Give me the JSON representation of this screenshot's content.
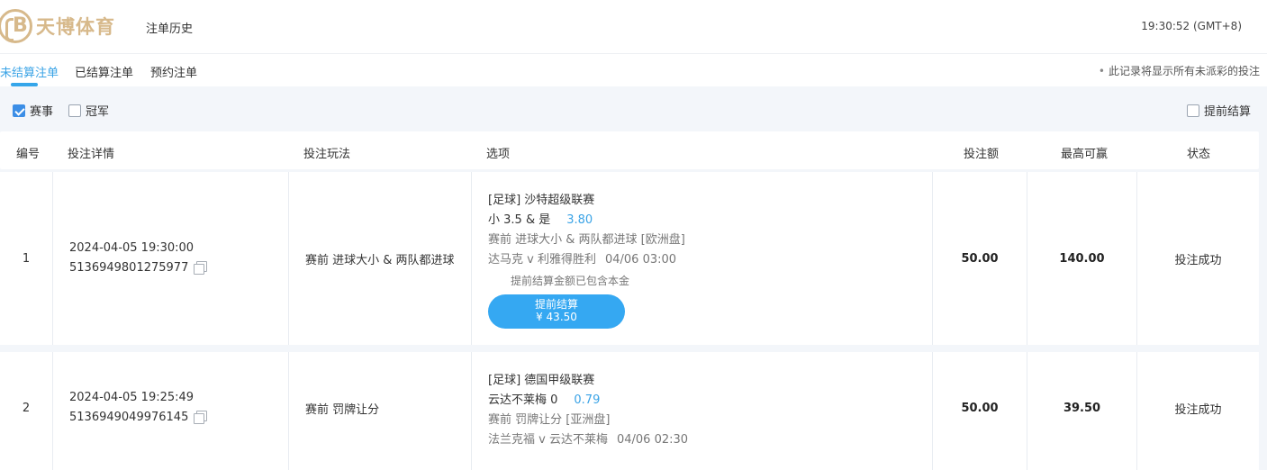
{
  "header": {
    "logo_text": "天博体育",
    "logo_mark": "B",
    "nav_history": "注单历史",
    "clock": "19:30:52 (GMT+8)"
  },
  "tabs": {
    "items": [
      {
        "label": "未结算注单",
        "active": true
      },
      {
        "label": "已结算注单",
        "active": false
      },
      {
        "label": "预约注单",
        "active": false
      }
    ],
    "note": "此记录将显示所有未派彩的投注"
  },
  "filter": {
    "match_label": "赛事",
    "match_checked": true,
    "champion_label": "冠军",
    "champion_checked": false,
    "early_settle_label": "提前结算",
    "early_settle_checked": false
  },
  "table": {
    "columns": [
      "编号",
      "投注详情",
      "投注玩法",
      "选项",
      "投注额",
      "最高可赢",
      "状态"
    ],
    "rows": [
      {
        "index": "1",
        "datetime": "2024-04-05 19:30:00",
        "bet_id": "5136949801275977",
        "play": "赛前  进球大小 & 两队都进球",
        "league": "[足球] 沙特超级联赛",
        "selection": "小 3.5 & 是",
        "odds": "3.80",
        "market": "赛前 进球大小 & 两队都进球 [欧洲盘]",
        "match": "达马克 v 利雅得胜利",
        "match_time": "04/06 03:00",
        "settle_note": "提前结算金额已包含本金",
        "settle_btn_label": "提前结算",
        "settle_btn_amount": "¥ 43.50",
        "stake": "50.00",
        "max_win": "140.00",
        "status": "投注成功"
      },
      {
        "index": "2",
        "datetime": "2024-04-05 19:25:49",
        "bet_id": "5136949049976145",
        "play": "赛前  罚牌让分",
        "league": "[足球] 德国甲级联赛",
        "selection": "云达不莱梅 0",
        "odds": "0.79",
        "market": "赛前 罚牌让分 [亚洲盘]",
        "match": "法兰克福 v 云达不莱梅",
        "match_time": "04/06 02:30",
        "stake": "50.00",
        "max_win": "39.50",
        "status": "投注成功"
      }
    ]
  },
  "colors": {
    "brand_gold": "#d7b98b",
    "accent_blue": "#3aa3e6",
    "button_blue": "#35a8f2",
    "strip_bg": "#f3f6fa"
  }
}
